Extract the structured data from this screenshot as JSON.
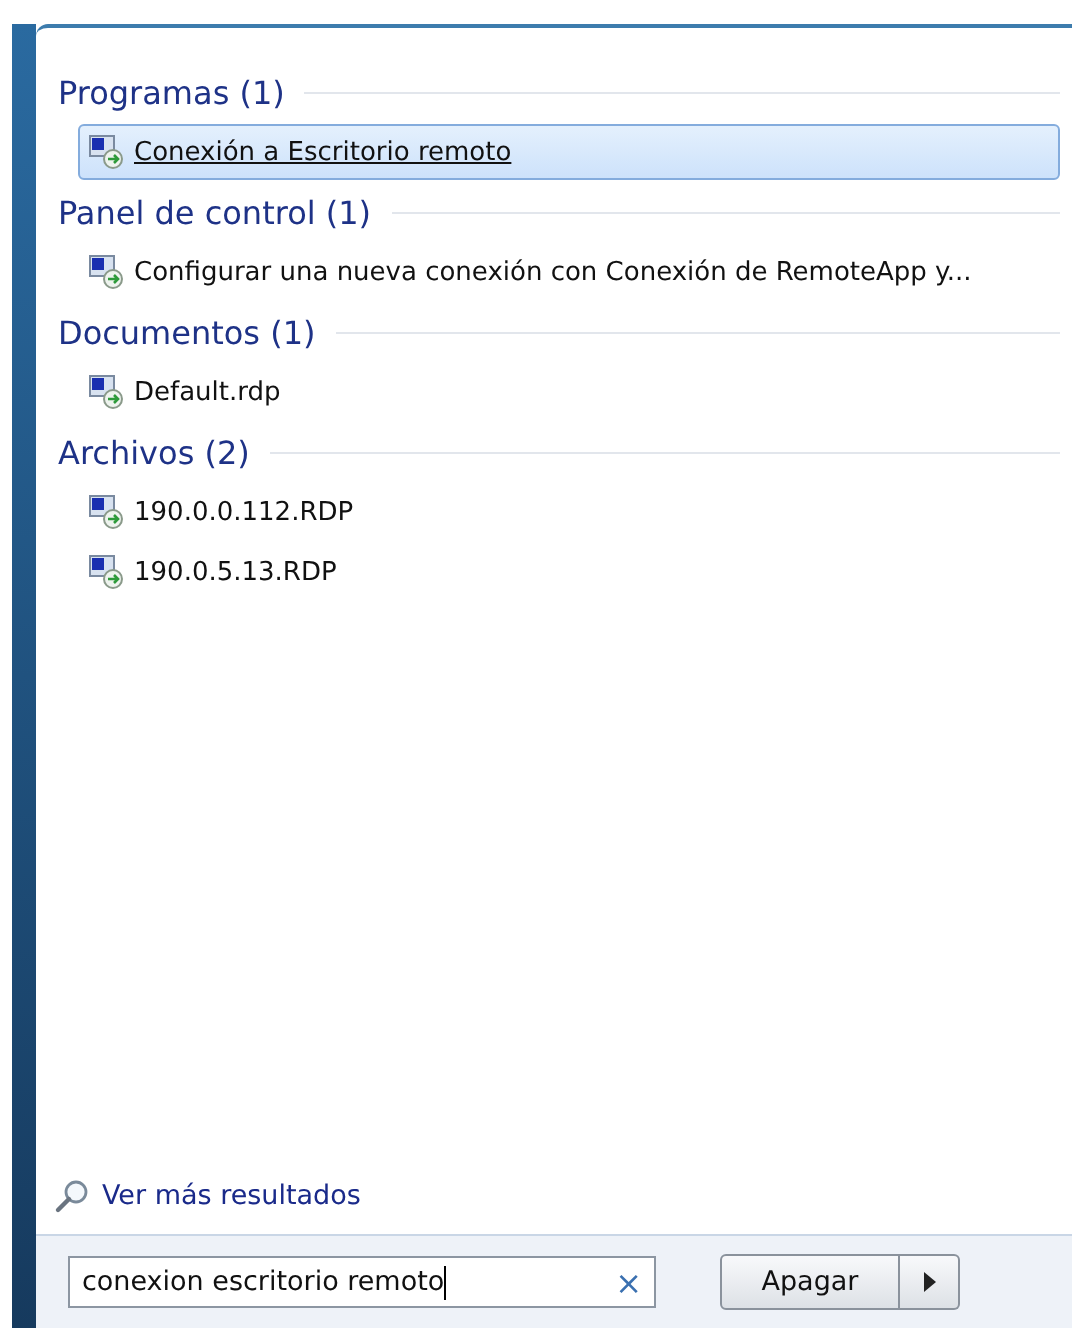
{
  "groups": [
    {
      "title": "Programas (1)",
      "items": [
        {
          "label": "Conexión a Escritorio remoto",
          "selected": true
        }
      ]
    },
    {
      "title": "Panel de control (1)",
      "items": [
        {
          "label": "Configurar una nueva conexión con Conexión de RemoteApp y...",
          "selected": false
        }
      ]
    },
    {
      "title": "Documentos (1)",
      "items": [
        {
          "label": "Default.rdp",
          "selected": false
        }
      ]
    },
    {
      "title": "Archivos (2)",
      "items": [
        {
          "label": "190.0.0.112.RDP",
          "selected": false
        },
        {
          "label": "190.0.5.13.RDP",
          "selected": false
        }
      ]
    }
  ],
  "more_results": "Ver más resultados",
  "search": {
    "value": "conexion escritorio remoto",
    "clear": "×"
  },
  "shutdown_button": "Apagar"
}
